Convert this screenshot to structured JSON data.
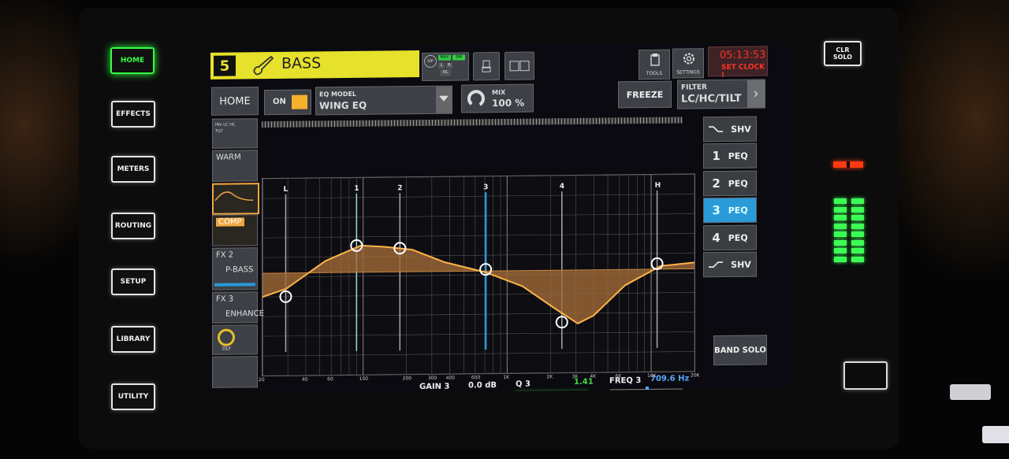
{
  "hardware_left": {
    "buttons": [
      {
        "label": "HOME",
        "active": true
      },
      {
        "label": "EFFECTS",
        "active": false
      },
      {
        "label": "METERS",
        "active": false
      },
      {
        "label": "ROUTING",
        "active": false
      },
      {
        "label": "SETUP",
        "active": false
      },
      {
        "label": "LIBRARY",
        "active": false
      },
      {
        "label": "UTILITY",
        "active": false
      }
    ]
  },
  "hardware_right": {
    "clr_solo_label": "CLR\nSOLO"
  },
  "header": {
    "channel_number": "5",
    "channel_name": "BASS",
    "status_indicators": [
      "SIP",
      "MAX",
      "SW",
      "L",
      "R",
      "SC"
    ],
    "tools_label": "TOOLS",
    "settings_label": "SETTINGS",
    "clock_time": "05:13:53",
    "clock_warning": "SET CLOCK !"
  },
  "eq_controls": {
    "home_label": "HOME",
    "on_label": "ON",
    "eq_model_caption": "EQ MODEL",
    "eq_model_value": "WING EQ",
    "mix_caption": "MIX",
    "mix_value": "100 %",
    "freeze_label": "FREEZE",
    "filter_caption": "FILTER",
    "filter_value": "LC/HC/TILT"
  },
  "left_modules": [
    {
      "label": "",
      "sub": "INV LC HC TILT"
    },
    {
      "label": "WARM"
    },
    {
      "label": ""
    },
    {
      "label": "COMP"
    },
    {
      "label": "FX 2",
      "sub": "P-BASS"
    },
    {
      "label": "FX 3",
      "sub": "ENHANCE"
    },
    {
      "label": "",
      "sub": "DLY"
    },
    {
      "label": ""
    }
  ],
  "bands": [
    {
      "num": "",
      "label": "SHV",
      "type": "shelf-low",
      "selected": false
    },
    {
      "num": "1",
      "label": "PEQ",
      "type": "peq",
      "selected": false
    },
    {
      "num": "2",
      "label": "PEQ",
      "type": "peq",
      "selected": false
    },
    {
      "num": "3",
      "label": "PEQ",
      "type": "peq",
      "selected": true
    },
    {
      "num": "4",
      "label": "PEQ",
      "type": "peq",
      "selected": false
    },
    {
      "num": "",
      "label": "SHV",
      "type": "shelf-high",
      "selected": false
    }
  ],
  "band_solo_label": "BAND SOLO",
  "graph_band_markers": [
    "L",
    "1",
    "2",
    "3",
    "4",
    "H"
  ],
  "freq_axis": [
    "20",
    "40",
    "60",
    "100",
    "200",
    "300",
    "400",
    "600",
    "1K",
    "2K",
    "3K",
    "4K",
    "6K",
    "10K",
    "20K"
  ],
  "bottom": {
    "gain_label": "GAIN 3",
    "gain_value": "0.0 dB",
    "q_label": "Q 3",
    "q_value": "1.41",
    "freq_label": "FREQ 3",
    "freq_value": "709.6 Hz"
  },
  "colors": {
    "accent_yellow": "#e6e12a",
    "curve_orange": "#f0a640",
    "band3_blue": "#2a9ad8",
    "green_led": "#33ff44",
    "clock_red": "#ff3322"
  }
}
